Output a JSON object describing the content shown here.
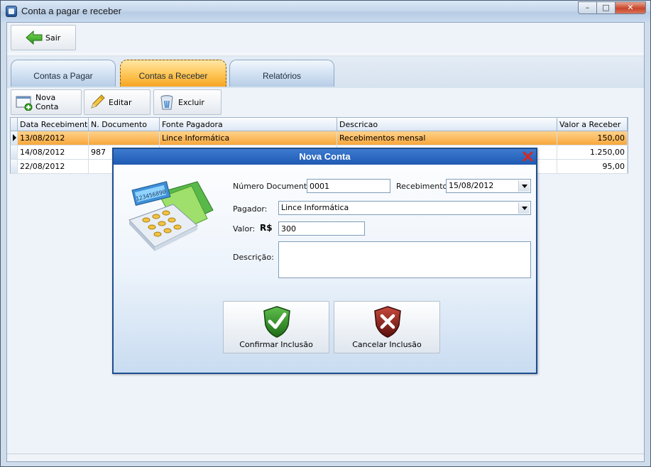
{
  "window": {
    "title": "Conta a pagar e receber",
    "controls": {
      "minimize": "–",
      "maximize": "□",
      "close": "✕"
    }
  },
  "toolbar": {
    "exit_label": "Sair",
    "exit_icon": "back-arrow-icon"
  },
  "tabs": [
    {
      "label": "Contas a Pagar",
      "active": false
    },
    {
      "label": "Contas a Receber",
      "active": true
    },
    {
      "label": "Relatórios",
      "active": false
    }
  ],
  "actions": {
    "new": "Nova Conta",
    "edit": "Editar",
    "delete": "Excluir"
  },
  "grid": {
    "columns": [
      "Data Recebimento",
      "N. Documento",
      "Fonte Pagadora",
      "Descricao",
      "Valor a Receber"
    ],
    "rows": [
      {
        "date": "13/08/2012",
        "doc": "",
        "source": "Lince Informática",
        "desc": "Recebimentos mensal",
        "value": "150,00"
      },
      {
        "date": "14/08/2012",
        "doc": "987",
        "source": "",
        "desc": "",
        "value": "1.250,00"
      },
      {
        "date": "22/08/2012",
        "doc": "",
        "source": "",
        "desc": "",
        "value": "95,00"
      }
    ]
  },
  "dialog": {
    "title": "Nova Conta",
    "doc_label": "Número Documento:",
    "doc_value": "0001",
    "date_label": "Recebimento:",
    "date_value": "15/08/2012",
    "payer_label": "Pagador:",
    "payer_value": "Lince Informática",
    "value_label": "Valor:",
    "currency": "R$",
    "amount_value": "300",
    "desc_label": "Descrição:",
    "confirm_label": "Confirmar Inclusão",
    "cancel_label": "Cancelar Inclusão",
    "calculator_display": "123456890"
  },
  "colors": {
    "accent_orange": "#f5a623",
    "dialog_title": "#1f5ab2",
    "confirm_green": "#2e8b22",
    "cancel_red": "#8b1a1a"
  }
}
